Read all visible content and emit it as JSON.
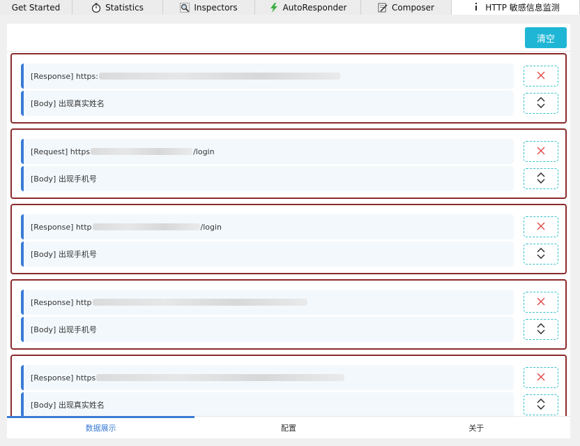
{
  "tabs": [
    {
      "label": "Get Started",
      "icon": "none"
    },
    {
      "label": "Statistics",
      "icon": "stopwatch-icon"
    },
    {
      "label": "Inspectors",
      "icon": "magnifier-icon"
    },
    {
      "label": "AutoResponder",
      "icon": "lightning-icon"
    },
    {
      "label": "Composer",
      "icon": "compose-icon"
    },
    {
      "label": "HTTP 敏感信息监测",
      "icon": "info-icon"
    }
  ],
  "toolbar": {
    "clear_label": "清空"
  },
  "entries": [
    {
      "line1_prefix": "[Response] https:",
      "line1_suffix": "",
      "line2": "[Body] 出现真实姓名"
    },
    {
      "line1_prefix": "[Request] https",
      "line1_suffix": "/login",
      "line2": "[Body] 出现手机号"
    },
    {
      "line1_prefix": "[Response] http",
      "line1_suffix": "/login",
      "line2": "[Body] 出现手机号"
    },
    {
      "line1_prefix": "[Response] http",
      "line1_suffix": "",
      "line2": "[Body] 出现手机号"
    },
    {
      "line1_prefix": "[Response] https",
      "line1_suffix": "",
      "line2": "[Body] 出现真实姓名"
    }
  ],
  "bottom_tabs": [
    {
      "label": "数据展示",
      "active": true
    },
    {
      "label": "配置",
      "active": false
    },
    {
      "label": "关于",
      "active": false
    }
  ],
  "colors": {
    "accent": "#3a7bd5",
    "clear_button": "#1fb6d6",
    "card_border": "#8b2a2a",
    "delete_x": "#e04b4b"
  }
}
